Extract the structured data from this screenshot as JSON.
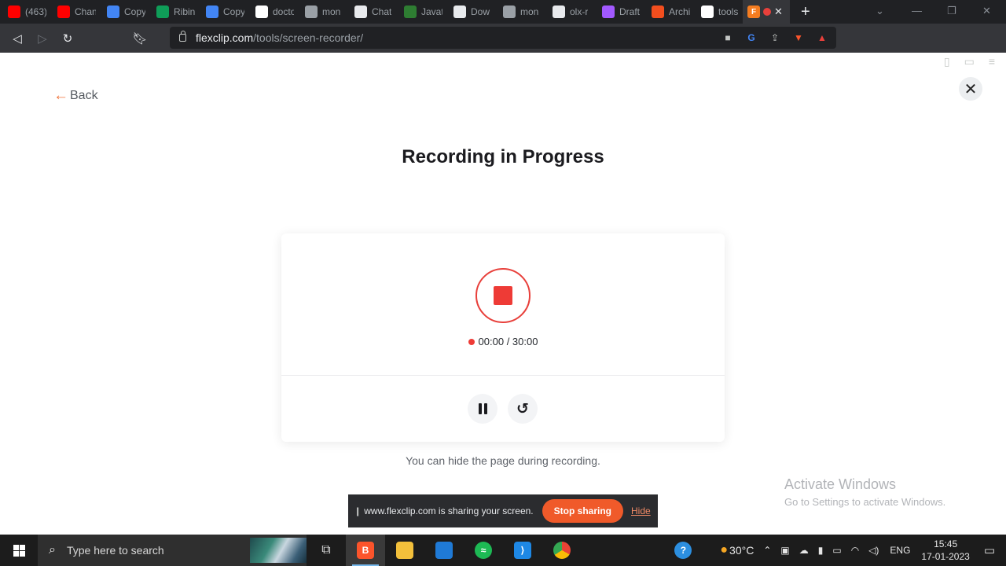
{
  "browser": {
    "tabs": [
      {
        "label": "(463)",
        "icon": "youtube-icon",
        "color": "#ff0000"
      },
      {
        "label": "Chan",
        "icon": "youtube-icon",
        "color": "#ff0000"
      },
      {
        "label": "Copy",
        "icon": "docs-icon",
        "color": "#4285f4"
      },
      {
        "label": "Ribin",
        "icon": "sheets-icon",
        "color": "#0f9d58"
      },
      {
        "label": "Copy",
        "icon": "docs-icon",
        "color": "#4285f4"
      },
      {
        "label": "docto",
        "icon": "google-icon",
        "color": "#ffffff"
      },
      {
        "label": "mon",
        "icon": "globe-icon",
        "color": "#9aa0a6"
      },
      {
        "label": "Chat",
        "icon": "openai-icon",
        "color": "#e8eaed"
      },
      {
        "label": "Javat",
        "icon": "w-icon",
        "color": "#2e7d32"
      },
      {
        "label": "Dow",
        "icon": "download-icon",
        "color": "#e8eaed"
      },
      {
        "label": "mon",
        "icon": "globe-icon",
        "color": "#9aa0a6"
      },
      {
        "label": "olx-r",
        "icon": "github-icon",
        "color": "#e8eaed"
      },
      {
        "label": "Draft",
        "icon": "figma-icon",
        "color": "#a259ff"
      },
      {
        "label": "Archi",
        "icon": "figma-icon",
        "color": "#f24e1e"
      },
      {
        "label": "tools",
        "icon": "google-icon",
        "color": "#ffffff"
      }
    ],
    "active_tab": {
      "icon": "flexclip-icon",
      "color": "#f47c20"
    },
    "new_tab": "+",
    "url_host": "flexclip.com",
    "url_path": "/tools/screen-recorder/"
  },
  "page": {
    "back_label": "Back",
    "title": "Recording in Progress",
    "timer": "00:00 / 30:00",
    "hint": "You can hide the page during recording.",
    "accent_color": "#ee3b36"
  },
  "sharebar": {
    "message": "www.flexclip.com is sharing your screen.",
    "stop_label": "Stop sharing",
    "hide_label": "Hide"
  },
  "watermark": {
    "line1": "Activate Windows",
    "line2": "Go to Settings to activate Windows."
  },
  "taskbar": {
    "search_placeholder": "Type here to search",
    "weather": "30°C",
    "language": "ENG",
    "time": "15:45",
    "date": "17-01-2023"
  }
}
